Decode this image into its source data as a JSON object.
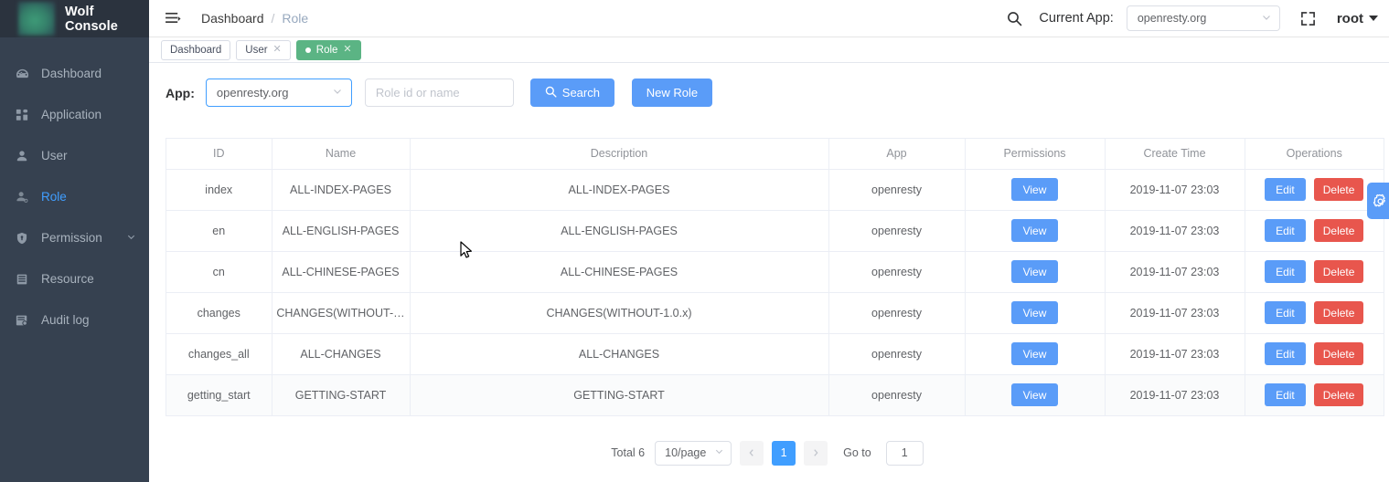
{
  "brand": {
    "title": "Wolf Console",
    "logo_icon": "wolf-logo"
  },
  "sidebar": {
    "items": [
      {
        "label": "Dashboard",
        "icon": "dashboard-icon",
        "active": false,
        "caret": false
      },
      {
        "label": "Application",
        "icon": "grid-icon",
        "active": false,
        "caret": false
      },
      {
        "label": "User",
        "icon": "user-icon",
        "active": false,
        "caret": false
      },
      {
        "label": "Role",
        "icon": "role-icon",
        "active": true,
        "caret": false
      },
      {
        "label": "Permission",
        "icon": "shield-icon",
        "active": false,
        "caret": true
      },
      {
        "label": "Resource",
        "icon": "resource-icon",
        "active": false,
        "caret": false
      },
      {
        "label": "Audit log",
        "icon": "audit-log-icon",
        "active": false,
        "caret": false
      }
    ]
  },
  "topbar": {
    "menu_toggle_icon": "hamburger-icon",
    "breadcrumb": {
      "root": "Dashboard",
      "separator": "/",
      "current": "Role"
    },
    "search_icon": "search-icon",
    "current_app_label": "Current App:",
    "current_app_value": "openresty.org",
    "fullscreen_icon": "fullscreen-icon",
    "user": "root"
  },
  "tabs": [
    {
      "label": "Dashboard",
      "active": false,
      "closable": false
    },
    {
      "label": "User",
      "active": false,
      "closable": true
    },
    {
      "label": "Role",
      "active": true,
      "closable": true
    }
  ],
  "toolbar": {
    "app_label": "App:",
    "app_value": "openresty.org",
    "search_placeholder": "Role id or name",
    "search_value": "",
    "search_button": "Search",
    "search_icon": "search-icon",
    "new_button": "New Role"
  },
  "table": {
    "columns": [
      "ID",
      "Name",
      "Description",
      "App",
      "Permissions",
      "Create Time",
      "Operations"
    ],
    "view_label": "View",
    "edit_label": "Edit",
    "delete_label": "Delete",
    "rows": [
      {
        "id": "index",
        "name": "ALL-INDEX-PAGES",
        "description": "ALL-INDEX-PAGES",
        "app": "openresty",
        "create_time": "2019-11-07 23:03",
        "hovered": false
      },
      {
        "id": "en",
        "name": "ALL-ENGLISH-PAGES",
        "description": "ALL-ENGLISH-PAGES",
        "app": "openresty",
        "create_time": "2019-11-07 23:03",
        "hovered": false
      },
      {
        "id": "cn",
        "name": "ALL-CHINESE-PAGES",
        "description": "ALL-CHINESE-PAGES",
        "app": "openresty",
        "create_time": "2019-11-07 23:03",
        "hovered": false
      },
      {
        "id": "changes",
        "name": "CHANGES(WITHOUT-…",
        "description": "CHANGES(WITHOUT-1.0.x)",
        "app": "openresty",
        "create_time": "2019-11-07 23:03",
        "hovered": false
      },
      {
        "id": "changes_all",
        "name": "ALL-CHANGES",
        "description": "ALL-CHANGES",
        "app": "openresty",
        "create_time": "2019-11-07 23:03",
        "hovered": false
      },
      {
        "id": "getting_start",
        "name": "GETTING-START",
        "description": "GETTING-START",
        "app": "openresty",
        "create_time": "2019-11-07 23:03",
        "hovered": true
      }
    ]
  },
  "pagination": {
    "total": "Total 6",
    "page_size": "10/page",
    "prev_icon": "chevron-left-icon",
    "next_icon": "chevron-right-icon",
    "current_page": "1",
    "goto_label": "Go to",
    "goto_value": "1"
  },
  "floating": {
    "gear_icon": "gear-icon"
  },
  "colors": {
    "sidebar_bg": "#364150",
    "sidebar_logo_bg": "#2b333e",
    "accent_blue": "#5a9cf8",
    "active_link": "#409eff",
    "tab_green": "#5bb484",
    "danger_red": "#e8564d",
    "border": "#ebeef5",
    "text_muted": "#909399"
  }
}
